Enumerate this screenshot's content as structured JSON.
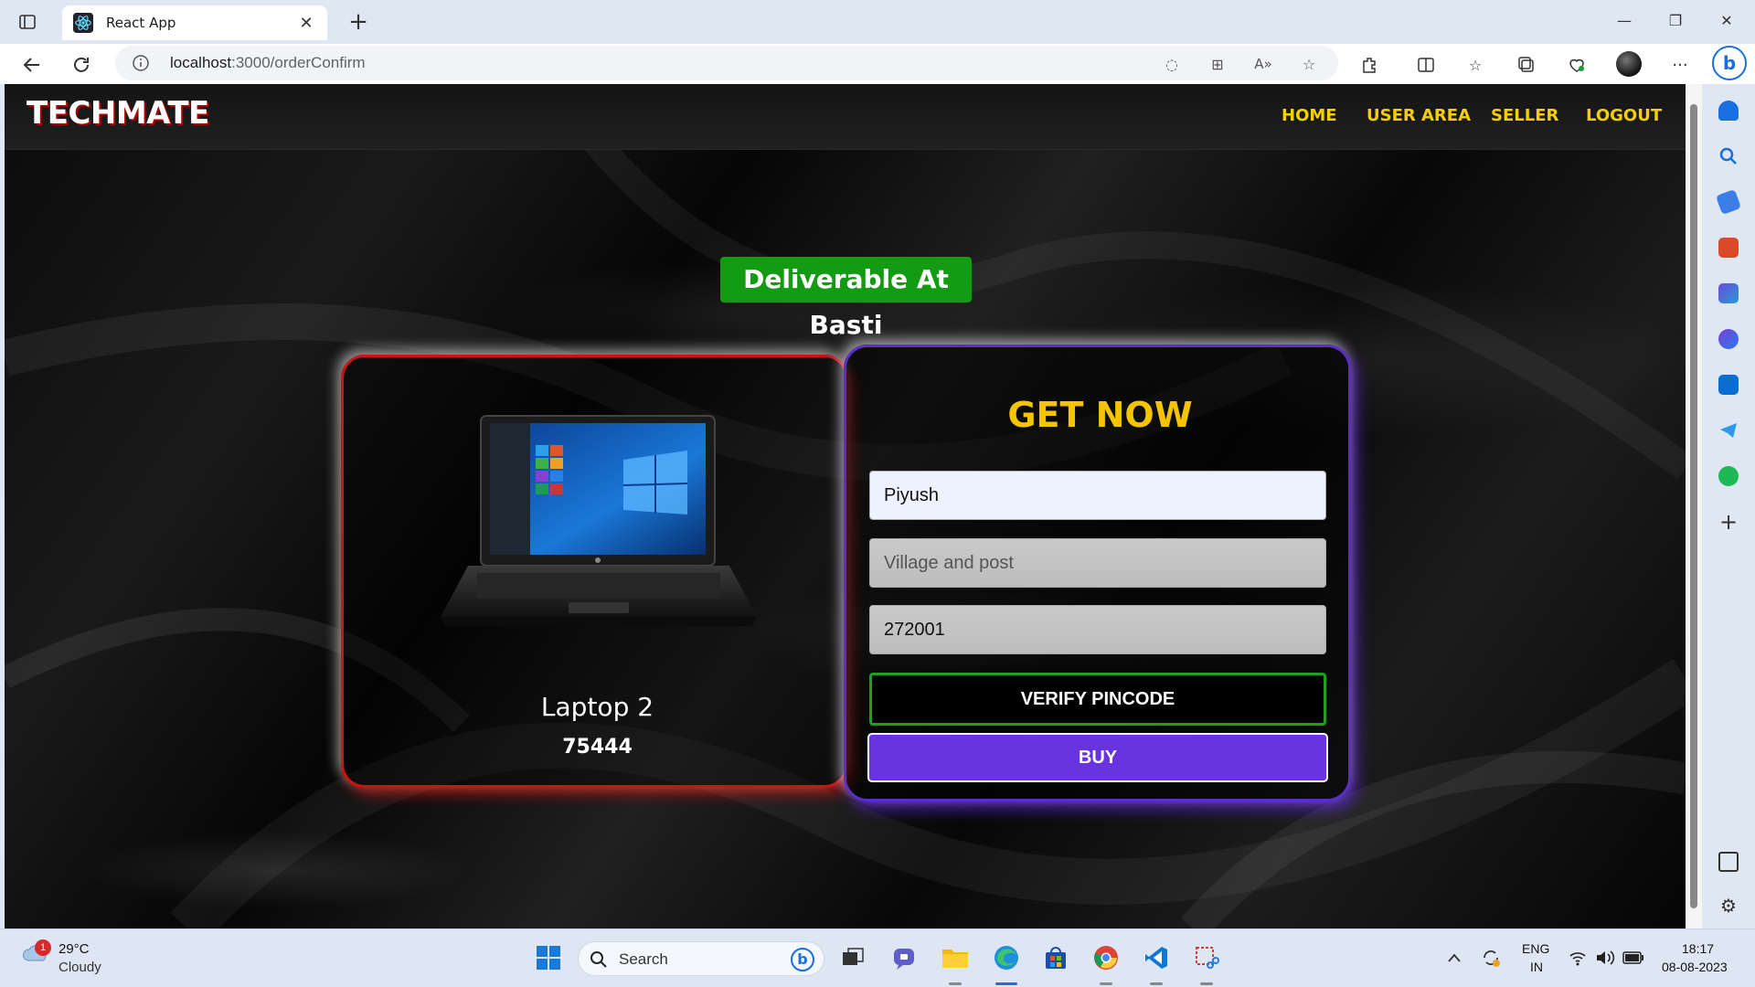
{
  "browser": {
    "tab_title": "React App",
    "url_host": "localhost",
    "url_path": ":3000/orderConfirm"
  },
  "site": {
    "brand": "TECHMATE",
    "nav": [
      "HOME",
      "USER AREA",
      "SELLER",
      "LOGOUT"
    ]
  },
  "delivery_message": "Deliverable At Basti",
  "product": {
    "name": "Laptop 2",
    "price": "75444"
  },
  "order_form": {
    "heading": "GET NOW",
    "name_value": "Piyush",
    "address_placeholder": "Village and post",
    "address_value": "",
    "pincode_value": "272001",
    "verify_label": "VERIFY PINCODE",
    "buy_label": "BUY"
  },
  "taskbar": {
    "weather_temp": "29°C",
    "weather_desc": "Cloudy",
    "weather_badge": "1",
    "search_label": "Search",
    "lang_top": "ENG",
    "lang_bottom": "IN",
    "time": "18:17",
    "date": "08-08-2023"
  },
  "colors": {
    "brand_accent": "#f5d000",
    "deliver_green": "#139b13",
    "buy_purple": "#6a33e0",
    "card_red": "#c91515"
  }
}
